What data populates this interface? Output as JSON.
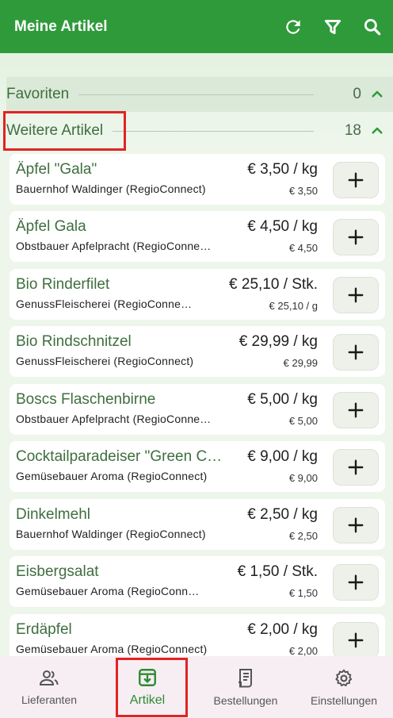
{
  "appbar": {
    "title": "Meine Artikel",
    "actions": [
      {
        "icon": "refresh-icon"
      },
      {
        "icon": "filter-icon"
      },
      {
        "icon": "search-icon"
      }
    ]
  },
  "sections": {
    "favorites": {
      "label": "Favoriten",
      "count": "0"
    },
    "more": {
      "label": "Weitere Artikel",
      "count": "18"
    }
  },
  "articles": [
    {
      "name": "Äpfel \"Gala\"",
      "supplier": "Bauernhof Waldinger (RegioConnect)",
      "price": "€ 3,50 / kg",
      "unit_price": "€ 3,50"
    },
    {
      "name": "Äpfel Gala",
      "supplier": "Obstbauer Apfelpracht (RegioConne…",
      "price": "€ 4,50 / kg",
      "unit_price": "€ 4,50"
    },
    {
      "name": "Bio Rinderfilet",
      "supplier": "GenussFleischerei (RegioConne…",
      "price": "€ 25,10 / Stk.",
      "unit_price": "€ 25,10 / g"
    },
    {
      "name": "Bio Rindschnitzel",
      "supplier": "GenussFleischerei (RegioConnect)",
      "price": "€ 29,99 / kg",
      "unit_price": "€ 29,99"
    },
    {
      "name": "Boscs Flaschenbirne",
      "supplier": "Obstbauer Apfelpracht (RegioConne…",
      "price": "€ 5,00 / kg",
      "unit_price": "€ 5,00"
    },
    {
      "name": "Cocktailparadeiser \"Green C…",
      "supplier": "Gemüsebauer Aroma (RegioConnect)",
      "price": "€ 9,00 / kg",
      "unit_price": "€ 9,00"
    },
    {
      "name": "Dinkelmehl",
      "supplier": "Bauernhof Waldinger (RegioConnect)",
      "price": "€ 2,50 / kg",
      "unit_price": "€ 2,50"
    },
    {
      "name": "Eisbergsalat",
      "supplier": "Gemüsebauer Aroma (RegioConn…",
      "price": "€ 1,50 / Stk.",
      "unit_price": "€ 1,50"
    },
    {
      "name": "Erdäpfel",
      "supplier": "Gemüsebauer Aroma (RegioConnect)",
      "price": "€ 2,00 / kg",
      "unit_price": "€ 2,00"
    }
  ],
  "nav": {
    "items": [
      {
        "label": "Lieferanten",
        "icon": "people-icon"
      },
      {
        "label": "Artikel",
        "icon": "archive-download-icon",
        "active": true
      },
      {
        "label": "Bestellungen",
        "icon": "receipt-icon"
      },
      {
        "label": "Einstellungen",
        "icon": "gear-icon"
      }
    ]
  },
  "colors": {
    "primary": "#2e9a3a",
    "text_green": "#3f6e3f",
    "highlight": "#e02424",
    "background": "#eef6ec",
    "nav_bg": "#f7eef4"
  }
}
